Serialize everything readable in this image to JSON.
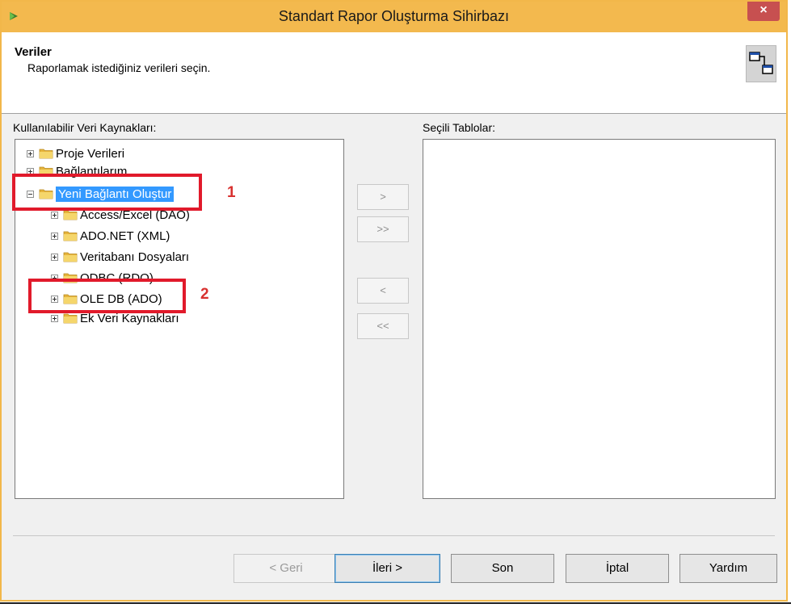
{
  "window": {
    "title": "Standart Rapor Oluşturma Sihirbazı",
    "close_label": "×",
    "accent_color": "#f3b94e"
  },
  "header": {
    "title": "Veriler",
    "subtitle": "Raporlamak istediğiniz verileri seçin."
  },
  "available": {
    "label": "Kullanılabilir Veri Kaynakları:",
    "items": [
      {
        "label": "Proje Verileri",
        "level": 0,
        "expander": "plus",
        "selected": false
      },
      {
        "label": "Bağlantılarım",
        "level": 0,
        "expander": "plus",
        "selected": false
      },
      {
        "label": "Yeni Bağlantı Oluştur",
        "level": 0,
        "expander": "minus",
        "selected": true
      },
      {
        "label": "Access/Excel (DAO)",
        "level": 1,
        "expander": "plus",
        "selected": false
      },
      {
        "label": "ADO.NET (XML)",
        "level": 1,
        "expander": "plus",
        "selected": false
      },
      {
        "label": "Veritabanı Dosyaları",
        "level": 1,
        "expander": "plus",
        "selected": false
      },
      {
        "label": "ODBC (RDO)",
        "level": 1,
        "expander": "plus",
        "selected": false
      },
      {
        "label": "OLE DB (ADO)",
        "level": 1,
        "expander": "plus",
        "selected": false
      },
      {
        "label": "Ek Veri Kaynakları",
        "level": 1,
        "expander": "plus",
        "selected": false
      }
    ]
  },
  "selected_tables": {
    "label": "Seçili Tablolar:"
  },
  "transfer_buttons": {
    "add": ">",
    "add_all": ">>",
    "remove": "<",
    "remove_all": "<<"
  },
  "annotations": {
    "one": "1",
    "two": "2"
  },
  "footer": {
    "back": "< Geri",
    "next": "İleri >",
    "finish": "Son",
    "cancel": "İptal",
    "help": "Yardım"
  }
}
